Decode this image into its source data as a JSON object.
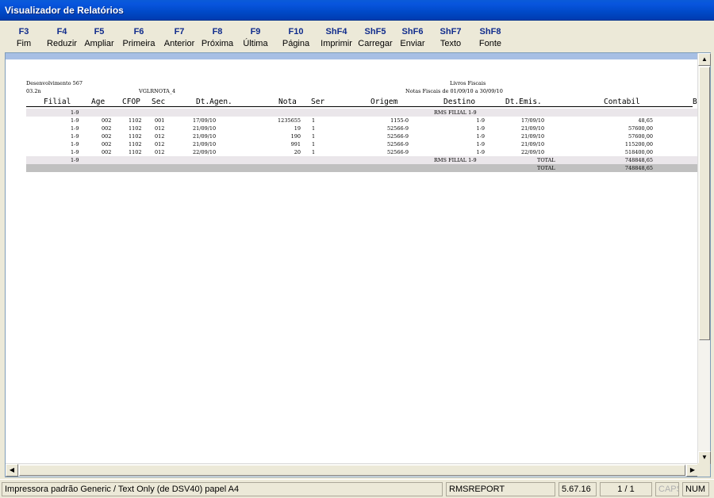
{
  "window": {
    "title": "Visualizador de Relatórios"
  },
  "toolbar": [
    {
      "key": "F3",
      "label": "Fim"
    },
    {
      "key": "F4",
      "label": "Reduzir"
    },
    {
      "key": "F5",
      "label": "Ampliar"
    },
    {
      "key": "F6",
      "label": "Primeira"
    },
    {
      "key": "F7",
      "label": "Anterior"
    },
    {
      "key": "F8",
      "label": "Próxima"
    },
    {
      "key": "F9",
      "label": "Última"
    },
    {
      "key": "F10",
      "label": "Página"
    },
    {
      "key": "ShF4",
      "label": "Imprimir"
    },
    {
      "key": "ShF5",
      "label": "Carregar"
    },
    {
      "key": "ShF6",
      "label": "Enviar"
    },
    {
      "key": "ShF7",
      "label": "Texto"
    },
    {
      "key": "ShF8",
      "label": "Fonte"
    }
  ],
  "report": {
    "company": "Desenvolvimento 567",
    "version": "03.2n",
    "program": "VGLRNOTA_4",
    "title": "Livros Fiscais",
    "subtitle": "Notas Fiscais de 01/09/10 a 30/09/10",
    "columns": [
      "Filial",
      "Age",
      "CFOP",
      "Sec",
      "Dt.Agen.",
      "Nota",
      "Ser",
      "Origem",
      "Destino",
      "Dt.Emis.",
      "Contabil",
      "B"
    ],
    "group_header": {
      "filial": "1-9",
      "destino": "RMS FILIAL 1-9"
    },
    "rows": [
      {
        "filial": "1-9",
        "age": "002",
        "cfop": "1102",
        "sec": "001",
        "dt_agen": "17/09/10",
        "nota": "1235655",
        "ser": "1",
        "origem": "1155-0",
        "destino": "1-9",
        "dt_emis": "17/09/10",
        "contabil": "48,65"
      },
      {
        "filial": "1-9",
        "age": "002",
        "cfop": "1102",
        "sec": "012",
        "dt_agen": "21/09/10",
        "nota": "19",
        "ser": "1",
        "origem": "52566-9",
        "destino": "1-9",
        "dt_emis": "21/09/10",
        "contabil": "57600,00"
      },
      {
        "filial": "1-9",
        "age": "002",
        "cfop": "1102",
        "sec": "012",
        "dt_agen": "21/09/10",
        "nota": "190",
        "ser": "1",
        "origem": "52566-9",
        "destino": "1-9",
        "dt_emis": "21/09/10",
        "contabil": "57600,00"
      },
      {
        "filial": "1-9",
        "age": "002",
        "cfop": "1102",
        "sec": "012",
        "dt_agen": "21/09/10",
        "nota": "991",
        "ser": "1",
        "origem": "52566-9",
        "destino": "1-9",
        "dt_emis": "21/09/10",
        "contabil": "115200,00"
      },
      {
        "filial": "1-9",
        "age": "002",
        "cfop": "1102",
        "sec": "012",
        "dt_agen": "22/09/10",
        "nota": "20",
        "ser": "1",
        "origem": "52566-9",
        "destino": "1-9",
        "dt_emis": "22/09/10",
        "contabil": "518400,00"
      }
    ],
    "group_total": {
      "filial": "1-9",
      "destino": "RMS FILIAL 1-9",
      "label": "TOTAL",
      "contabil": "748848,65"
    },
    "grand_total": {
      "label": "TOTAL",
      "contabil": "748848,65"
    }
  },
  "statusbar": {
    "printer": "Impressora padrão Generic / Text Only (de DSV40) papel A4",
    "report_name": "RMSREPORT",
    "version": "5.67.16",
    "page": "1 / 1",
    "caps": "CAPS",
    "num": "NUM"
  }
}
